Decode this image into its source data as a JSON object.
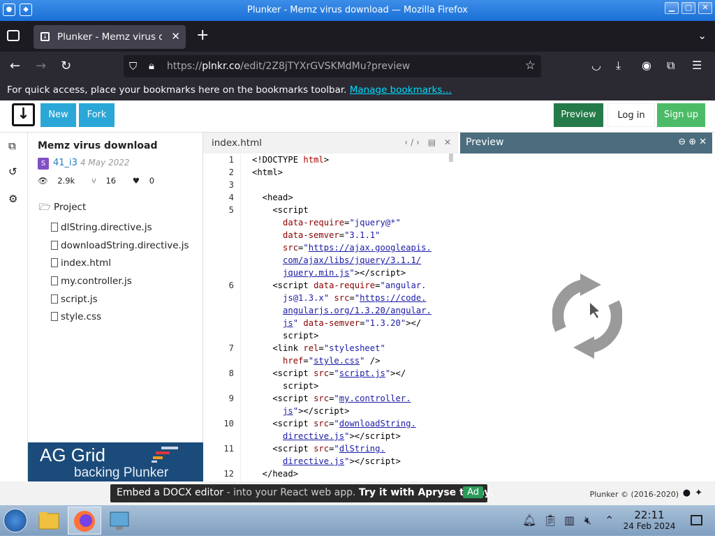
{
  "window": {
    "title": "Plunker - Memz virus download — Mozilla Firefox",
    "minimize": "▁",
    "maximize": "▢",
    "close": "✕"
  },
  "tab": {
    "label": "Plunker - Memz virus dow",
    "close": "✕",
    "new_tab": "+"
  },
  "nav": {
    "url_dim_prefix": "https://",
    "url_host": "plnkr.co",
    "url_path": "/edit/2Z8jTYXrGVSKMdMu?preview"
  },
  "bookmarks": {
    "text": "For quick access, place your bookmarks here on the bookmarks toolbar.",
    "link": "Manage bookmarks…"
  },
  "header": {
    "logo": "↓",
    "new_label": "New",
    "fork_label": "Fork",
    "preview_label": "Preview",
    "login_label": "Log in",
    "signup_label": "Sign up"
  },
  "project": {
    "name": "Memz virus download",
    "avatar_letter": "S",
    "user": "41_i3",
    "date": "4 May 2022",
    "views": "2.9k",
    "forks": "16",
    "likes": "0",
    "folder": "Project",
    "files": [
      "dlString.directive.js",
      "downloadString.directive.js",
      "index.html",
      "my.controller.js",
      "script.js",
      "style.css"
    ]
  },
  "ad_banner": {
    "brand": "AG Grid",
    "tagline": "backing Plunker"
  },
  "editor": {
    "filename": "index.html",
    "line_numbers": [
      "1",
      "2",
      "3",
      "4",
      "5",
      "6",
      "7",
      "8",
      "9",
      "10",
      "11",
      "12"
    ]
  },
  "preview": {
    "title": "Preview"
  },
  "footer": {
    "ad_plain": "Embed a DOCX editor",
    "ad_dim": " - into your React web app. ",
    "ad_bold": "Try it with Apryse today.",
    "ad_badge": "Ad",
    "credit": "Plunker © (2016-2020)"
  },
  "taskbar": {
    "time": "22:11",
    "date": "24 Feb 2024"
  },
  "colors": {
    "blue_button": "#2aa7d6",
    "preview_button": "#247a48",
    "signup_button": "#4cbb67",
    "preview_header": "#4b6d7e"
  }
}
